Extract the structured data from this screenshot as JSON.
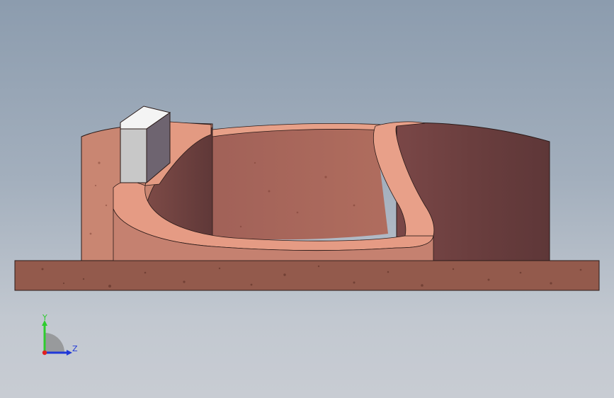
{
  "viewport": {
    "background_top": "#8c9cae",
    "background_bottom": "#c8ccd3",
    "model": "sectioned-circular-mold-on-base-plate"
  },
  "triad": {
    "y_label": "Y",
    "z_label": "Z",
    "y_color": "#2ecc2e",
    "z_color": "#2038d8",
    "x_color": "#e02020"
  },
  "colors": {
    "plate": "#935a4c",
    "section_face": "#e59b84",
    "outer_wall": "#c27a68",
    "inner_wall": "#a56456",
    "dark_wall": "#6e4140",
    "block_front": "#c8c8c8",
    "block_top": "#f4f4f4",
    "block_side": "#6e6470"
  }
}
